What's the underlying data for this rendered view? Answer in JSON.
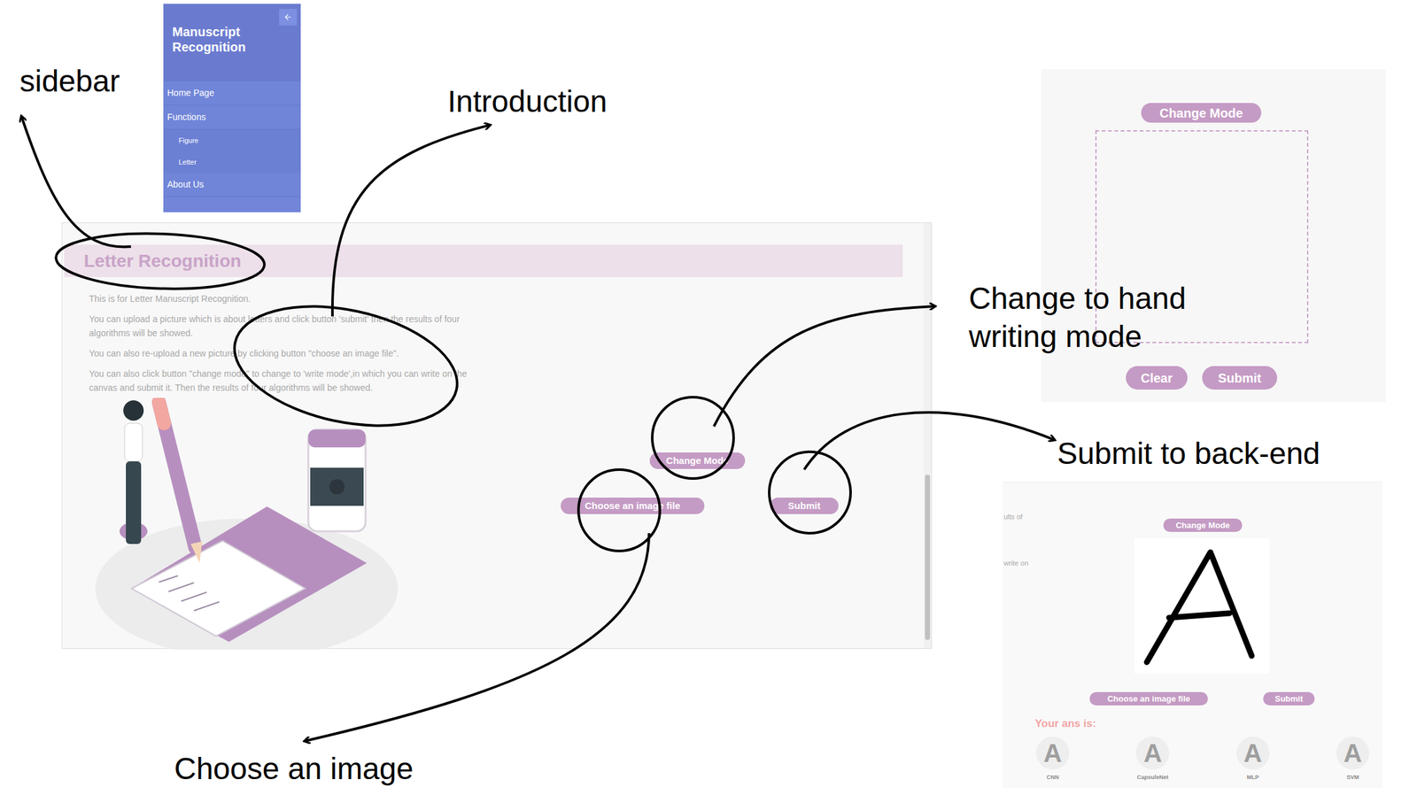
{
  "annotations": {
    "sidebar": "sidebar",
    "introduction": "Introduction",
    "change_mode": "Change to hand writing mode",
    "submit": "Submit to back-end",
    "choose_image": "Choose an image"
  },
  "sidebar": {
    "title": "Manuscript Recognition",
    "items": [
      {
        "label": "Home Page",
        "kind": "item"
      },
      {
        "label": "Functions",
        "kind": "item"
      },
      {
        "label": "Figure",
        "kind": "subitem"
      },
      {
        "label": "Letter",
        "kind": "subitem"
      },
      {
        "label": "About Us",
        "kind": "item"
      }
    ]
  },
  "main_screen": {
    "heading": "Letter Recognition",
    "paragraphs": [
      "This is for Letter Manuscript Recognition.",
      "You can upload a picture which is about letters and click button 'submit' then the results of four algorithms will be showed.",
      "You can also re-upload a new picture by clicking button \"choose an image file\".",
      "You can also click button \"change mode\" to change to 'write mode',in which you can write on the canvas and submit it. Then the results of four algorithms will be showed."
    ],
    "buttons": {
      "change_mode": "Change Mode",
      "choose": "Choose an image file",
      "submit": "Submit"
    }
  },
  "write_panel": {
    "buttons": {
      "change_mode": "Change Mode",
      "clear": "Clear",
      "submit": "Submit"
    }
  },
  "result_panel": {
    "fragments": [
      "ults of",
      "write on"
    ],
    "buttons": {
      "change_mode": "Change Mode",
      "choose": "Choose an image file",
      "submit": "Submit"
    },
    "answer_label": "Your ans is:",
    "results": [
      {
        "letter": "A",
        "model": "CNN"
      },
      {
        "letter": "A",
        "model": "CapsuleNet"
      },
      {
        "letter": "A",
        "model": "MLP"
      },
      {
        "letter": "A",
        "model": "SVM"
      }
    ]
  }
}
